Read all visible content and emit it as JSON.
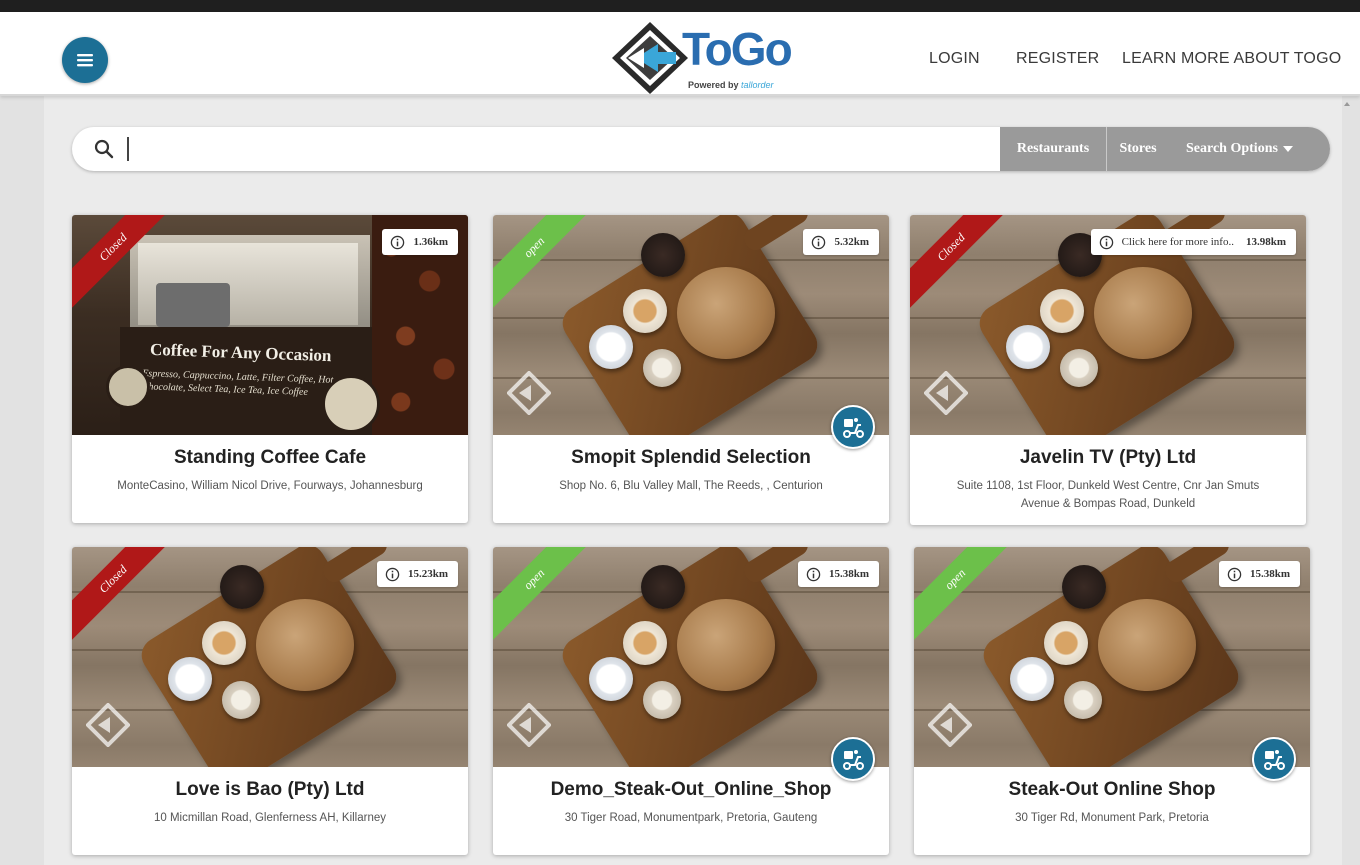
{
  "header": {
    "logo_text": "ToGo",
    "logo_tagline": "Powered by",
    "logo_brand": "tallorder",
    "nav": [
      "LOGIN",
      "REGISTER",
      "LEARN MORE ABOUT TOGO"
    ]
  },
  "search": {
    "value": "",
    "filters": {
      "restaurants": "Restaurants",
      "stores": "Stores",
      "options": "Search Options"
    }
  },
  "cards": [
    {
      "status": "Closed",
      "distance": "1.36km",
      "title": "Standing Coffee Cafe",
      "address": "MonteCasino, William Nicol Drive, Fourways, Johannesburg",
      "image": "coffee-cart",
      "sign_heading": "Coffee For Any Occasion",
      "sign_text": "Espresso, Cappuccino, Latte, Filter Coffee, Hot Chocolate, Select Tea, Ice Tea, Ice Coffee",
      "delivery": false
    },
    {
      "status": "open",
      "distance": "5.32km",
      "title": "Smopit Splendid Selection",
      "address": "Shop No. 6, Blu Valley Mall, The Reeds, , Centurion",
      "image": "bread-board",
      "delivery": true
    },
    {
      "status": "Closed",
      "distance_hint": "Click here for more info..",
      "distance": "13.98km",
      "title": "Javelin TV (Pty) Ltd",
      "address": "Suite 1108, 1st Floor, Dunkeld West Centre, Cnr Jan Smuts Avenue & Bompas Road, Dunkeld",
      "image": "bread-board",
      "delivery": false
    },
    {
      "status": "Closed",
      "distance": "15.23km",
      "title": "Love is Bao (Pty) Ltd",
      "address": "10 Micmillan Road, Glenferness AH, Killarney",
      "image": "bread-board",
      "delivery": false
    },
    {
      "status": "open",
      "distance": "15.38km",
      "title": "Demo_Steak-Out_Online_Shop",
      "address": "30 Tiger Road, Monumentpark, Pretoria, Gauteng",
      "image": "bread-board",
      "delivery": true
    },
    {
      "status": "open",
      "distance": "15.38km",
      "title": "Steak-Out Online Shop",
      "address": "30 Tiger Rd, Monument Park, Pretoria",
      "image": "bread-board",
      "delivery": true
    }
  ],
  "colors": {
    "primary": "#1c6f95",
    "closed": "#b01818",
    "open": "#6cc04a",
    "filter_bg": "#9a9a9a"
  },
  "icons": {
    "menu": "hamburger-icon",
    "search": "search-icon",
    "info": "info-icon",
    "delivery": "delivery-scooter-icon",
    "dropdown": "caret-down-icon"
  }
}
